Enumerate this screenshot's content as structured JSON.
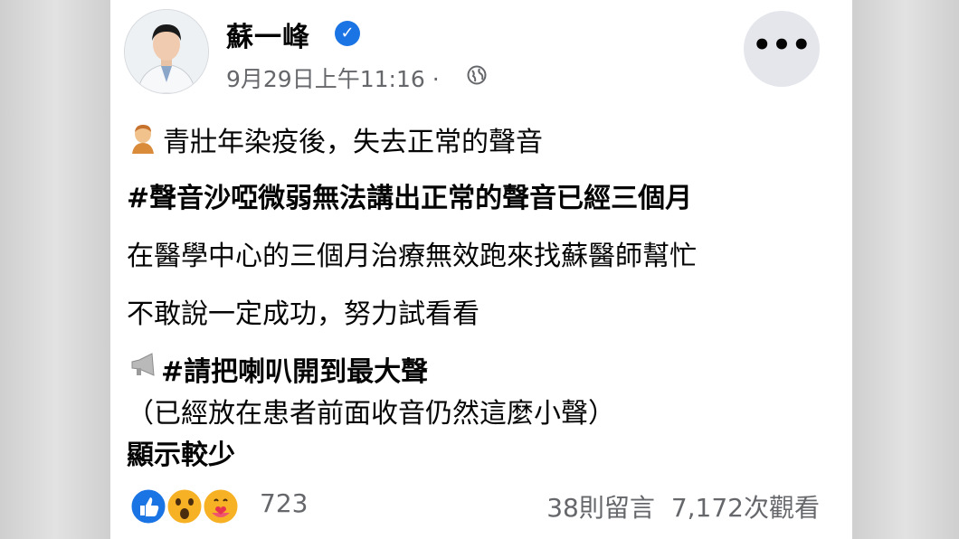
{
  "post": {
    "author": "蘇一峰",
    "timestamp": "9月29日上午11:16 ·",
    "verified_icon": "check-icon",
    "lines": [
      "青壯年染疫後，失去正常的聲音",
      "#聲音沙啞微弱無法講出正常的聲音已經三個月",
      "在醫學中心的三個月治療無效跑來找蘇醫師幫忙",
      "不敢說一定成功，努力試看看",
      "#請把喇叭開到最大聲",
      "（已經放在患者前面收音仍然這麼小聲）",
      "顯示較少"
    ]
  },
  "footer": {
    "reaction_count": "723",
    "comments": "38則留言",
    "views": "7,172次觀看"
  },
  "colors": {
    "accent": "#1b74e4",
    "secondary_text": "#65676b",
    "primary_text": "#050505"
  }
}
